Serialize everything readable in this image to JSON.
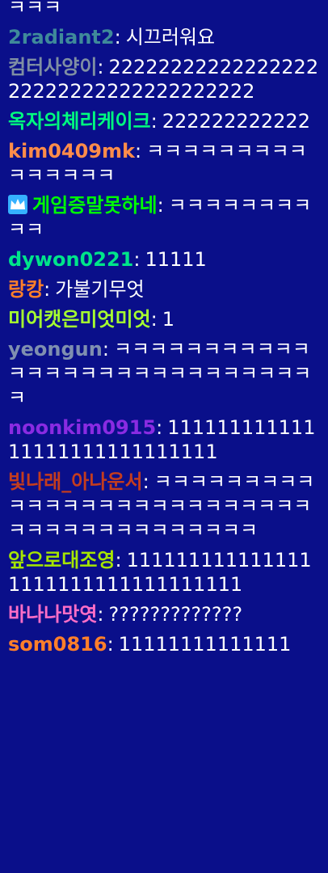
{
  "messages": [
    {
      "user": "",
      "user_color": "#ffffff",
      "text": "ㅋㅋㅋ"
    },
    {
      "user": "2radiant2",
      "user_color": "#3f8a9a",
      "text": "시끄러워요"
    },
    {
      "user": "컴터사양이",
      "user_color": "#7f8fa3",
      "text": "2222222222222222222222222222222222222"
    },
    {
      "user": "옥자의체리케이크",
      "user_color": "#00ff7f",
      "text": "222222222222"
    },
    {
      "user": "kim0409mk",
      "user_color": "#ff8c4a",
      "text": "ㅋㅋㅋㅋㅋㅋㅋㅋㅋㅋㅋㅋㅋㅋㅋ"
    },
    {
      "user": "게임증말못하네",
      "user_color": "#00ff00",
      "text": "ㅋㅋㅋㅋㅋㅋㅋㅋㅋㅋ",
      "badge": "crown-icon"
    },
    {
      "user": "dywon0221",
      "user_color": "#00e58a",
      "text": "11111"
    },
    {
      "user": "랑캉",
      "user_color": "#ff7f2a",
      "text": "가불기무엇"
    },
    {
      "user": "미어캣은미엇미엇",
      "user_color": "#a6ff2f",
      "text": "1"
    },
    {
      "user": "yeongun",
      "user_color": "#7f8fb0",
      "text": "ㅋㅋㅋㅋㅋㅋㅋㅋㅋㅋㅋㅋㅋㅋㅋㅋㅋㅋㅋㅋㅋㅋㅋㅋㅋㅋㅋㅋㅋ"
    },
    {
      "user": "noonkim0915",
      "user_color": "#8a2be2",
      "text": "11111111111111111111111111111"
    },
    {
      "user": "빛나래_아나운서",
      "user_color": "#c43c1e",
      "text": "ㅋㅋㅋㅋㅋㅋㅋㅋㅋㅋㅋㅋㅋㅋㅋㅋㅋㅋㅋㅋㅋㅋㅋㅋㅋㅋㅋㅋㅋㅋㅋㅋㅋㅋㅋㅋㅋㅋㅋㅋ"
    },
    {
      "user": "앞으로대조영",
      "user_color": "#a6e600",
      "text": "1111111111111111111111111111111111"
    },
    {
      "user": "바나나맛엿",
      "user_color": "#ff6ec7",
      "text": "?????????????"
    },
    {
      "user": "som0816",
      "user_color": "#ff7f2a",
      "text": "11111111111111"
    }
  ]
}
